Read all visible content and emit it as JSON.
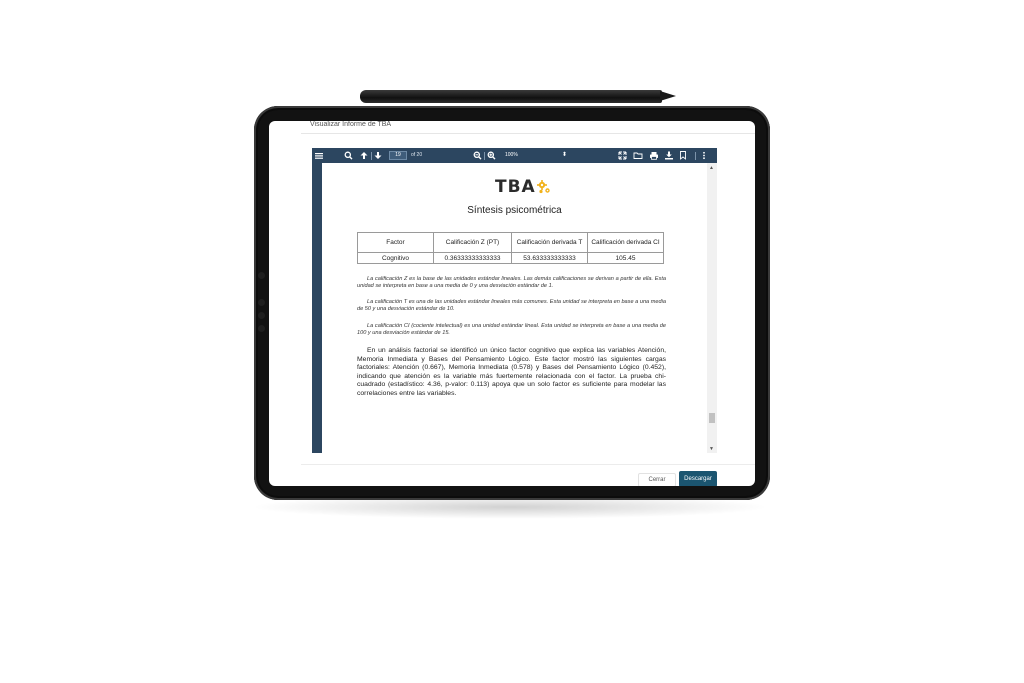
{
  "modal": {
    "title": "Visualizar Informe de TBA",
    "close_label": "Cerrar",
    "download_label": "Descargar"
  },
  "viewer": {
    "page_current": "19",
    "page_of": "of 20",
    "zoom": "100%",
    "toolbar_color": "#2c4660",
    "icons": [
      "menu-icon",
      "search-icon",
      "arrow-up-icon",
      "arrow-down-icon",
      "zoom-out-icon",
      "zoom-in-icon",
      "fullscreen-icon",
      "open-folder-icon",
      "print-icon",
      "download-icon",
      "bookmark-icon",
      "more-icon"
    ]
  },
  "document": {
    "logo": "TBA",
    "title": "Síntesis psicométrica",
    "table": {
      "headers": [
        "Factor",
        "Calificación Z (PT)",
        "Calificación derivada T",
        "Calificación derivada CI"
      ],
      "rows": [
        [
          "Cognitivo",
          "0.36333333333333",
          "53.633333333333",
          "105.45"
        ]
      ]
    },
    "notes": [
      "La calificación Z es la base de las unidades estándar lineales. Las demás calificaciones se derivan a partir de ella. Esta unidad se interpreta en base a una media de 0 y una desviación estándar de 1.",
      "La calificación T es una de las unidades estándar lineales más comunes. Esta unidad se interpreta en base a una media de 50 y una desviación estándar de 10.",
      "La calificación CI (cociente intelectual) es una unidad estándar lineal. Esta unidad se interpreta en base a una media de 100 y una desviación estándar de 15."
    ],
    "paragraph": "En un análisis factorial se identificó un único factor cognitivo que explica las variables Atención, Memoria Inmediata y Bases del Pensamiento Lógico. Este factor mostró las siguientes cargas factoriales: Atención (0.667), Memoria Inmediata (0.578) y Bases del Pensamiento Lógico (0.452), indicando que atención es la variable más fuertemente relacionada con el factor. La prueba chi-cuadrado (estadístico: 4.36, p-valor: 0.113) apoya que un solo factor es suficiente para modelar las correlaciones entre las variables."
  },
  "colors": {
    "accent": "#1b5570",
    "logo_gear": "#f2b21b"
  }
}
